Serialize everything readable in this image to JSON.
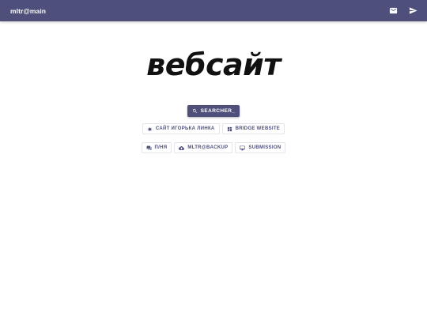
{
  "header": {
    "site_name": "mltr@main",
    "icons": [
      "mail-icon",
      "send-icon"
    ]
  },
  "logo": {
    "text": "вебсайт"
  },
  "search": {
    "label": "SEARCHER_",
    "icon": "search-icon"
  },
  "links_row1": [
    {
      "label": "САЙТ ИГОРЬКА ЛИНКА",
      "icon": "asterisk-icon"
    },
    {
      "label": "BRIDGE WEBSITE",
      "icon": "dashboard-icon"
    }
  ],
  "links_row2": [
    {
      "label": "П/НЯ",
      "icon": "chat-icon"
    },
    {
      "label": "MLTR@BACKUP",
      "icon": "cloud-icon"
    },
    {
      "label": "SUBMISSION",
      "icon": "monitor-icon"
    }
  ],
  "colors": {
    "accent": "#4e4f7a",
    "background": "#ffffff",
    "logo": "#111111"
  }
}
